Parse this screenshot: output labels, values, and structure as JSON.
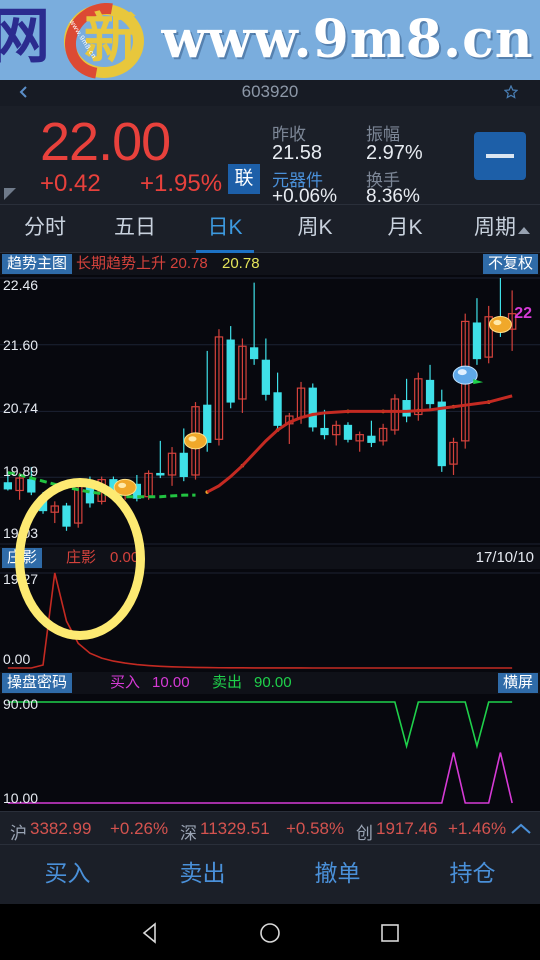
{
  "watermark": {
    "left_char": "网",
    "logo_glyph": "新",
    "logo_microtext": "www.9m8.cn",
    "url": "www.9m8.cn"
  },
  "topbar": {
    "stock_code": "603920",
    "back_icon": "back-arrow-icon",
    "star_icon": "star-icon"
  },
  "quote": {
    "price": "22.00",
    "change": "+0.42",
    "change_pct": "+1.95%",
    "link_badge": "联",
    "prev_close_label": "昨收",
    "prev_close_value": "21.58",
    "amplitude_label": "振幅",
    "amplitude_value": "2.97%",
    "sector_label": "元器件",
    "sector_value": "+0.06%",
    "turnover_label": "换手",
    "turnover_value": "8.36%",
    "collapse_icon": "minus-icon",
    "up_color": "#e8413c",
    "accent_color": "#1d5fa8"
  },
  "tabs": [
    {
      "label": "分时",
      "active": false
    },
    {
      "label": "五日",
      "active": false
    },
    {
      "label": "日K",
      "active": true
    },
    {
      "label": "周K",
      "active": false
    },
    {
      "label": "月K",
      "active": false
    },
    {
      "label": "周期",
      "active": false,
      "caret": true
    }
  ],
  "main_panel": {
    "badge": "趋势主图",
    "title_text": "长期趋势上升  20.78",
    "title_value": "20.78",
    "right_badge": "不复权",
    "axis": [
      "22.46",
      "21.60",
      "20.74",
      "19.89",
      "19.03"
    ],
    "price_tag": "22"
  },
  "sub_panel_1": {
    "badge": "庄影",
    "series_label": "庄影",
    "series_value": "0.00",
    "date": "17/10/10",
    "axis_top": "19.27",
    "axis_bottom": "0.00"
  },
  "sub_panel_2": {
    "badge": "操盘密码",
    "buy_label": "买入",
    "buy_value": "10.00",
    "sell_label": "卖出",
    "sell_value": "90.00",
    "right_badge": "横屏",
    "axis_top": "90.00",
    "axis_bottom": "10.00"
  },
  "indices": [
    {
      "name": "沪",
      "value": "3382.99",
      "pct": "+0.26%"
    },
    {
      "name": "深",
      "value": "11329.51",
      "pct": "+0.58%"
    },
    {
      "name": "创",
      "value": "1917.46",
      "pct": "+1.46%"
    }
  ],
  "index_expand_icon": "chevron-up-icon",
  "trade_actions": [
    "买入",
    "卖出",
    "撤单",
    "持仓"
  ],
  "android_nav": [
    "back-triangle-icon",
    "home-circle-icon",
    "recents-square-icon"
  ],
  "chart_data": {
    "type": "candlestick",
    "title": "趋势主图 — 603920 日K",
    "ylim": [
      19.03,
      22.46
    ],
    "yticks": [
      22.46,
      21.6,
      20.74,
      19.89,
      19.03
    ],
    "grid": true,
    "last_date": "17/10/10",
    "candles": [
      {
        "o": 19.82,
        "h": 19.96,
        "l": 19.72,
        "c": 19.74,
        "dir": "down"
      },
      {
        "o": 19.72,
        "h": 19.95,
        "l": 19.6,
        "c": 19.88,
        "dir": "up"
      },
      {
        "o": 19.86,
        "h": 20.02,
        "l": 19.66,
        "c": 19.7,
        "dir": "down"
      },
      {
        "o": 19.64,
        "h": 19.7,
        "l": 19.42,
        "c": 19.46,
        "dir": "down"
      },
      {
        "o": 19.44,
        "h": 19.58,
        "l": 19.3,
        "c": 19.52,
        "dir": "up"
      },
      {
        "o": 19.52,
        "h": 19.56,
        "l": 19.2,
        "c": 19.26,
        "dir": "down"
      },
      {
        "o": 19.3,
        "h": 19.82,
        "l": 19.24,
        "c": 19.78,
        "dir": "up"
      },
      {
        "o": 19.78,
        "h": 19.9,
        "l": 19.5,
        "c": 19.56,
        "dir": "down"
      },
      {
        "o": 19.58,
        "h": 19.9,
        "l": 19.54,
        "c": 19.86,
        "dir": "up"
      },
      {
        "o": 19.86,
        "h": 19.9,
        "l": 19.62,
        "c": 19.68,
        "dir": "down"
      },
      {
        "o": 19.7,
        "h": 19.86,
        "l": 19.6,
        "c": 19.82,
        "dir": "up"
      },
      {
        "o": 19.8,
        "h": 19.92,
        "l": 19.58,
        "c": 19.62,
        "dir": "down"
      },
      {
        "o": 19.64,
        "h": 19.98,
        "l": 19.6,
        "c": 19.94,
        "dir": "up"
      },
      {
        "o": 19.94,
        "h": 20.36,
        "l": 19.88,
        "c": 19.92,
        "dir": "down"
      },
      {
        "o": 19.92,
        "h": 20.28,
        "l": 19.78,
        "c": 20.2,
        "dir": "up"
      },
      {
        "o": 20.2,
        "h": 20.52,
        "l": 19.84,
        "c": 19.9,
        "dir": "down"
      },
      {
        "o": 19.92,
        "h": 20.86,
        "l": 19.86,
        "c": 20.8,
        "dir": "up"
      },
      {
        "o": 20.82,
        "h": 21.52,
        "l": 20.22,
        "c": 20.34,
        "dir": "down"
      },
      {
        "o": 20.38,
        "h": 21.8,
        "l": 20.3,
        "c": 21.7,
        "dir": "up"
      },
      {
        "o": 21.66,
        "h": 21.84,
        "l": 20.78,
        "c": 20.86,
        "dir": "down"
      },
      {
        "o": 20.9,
        "h": 21.68,
        "l": 20.72,
        "c": 21.58,
        "dir": "up"
      },
      {
        "o": 21.56,
        "h": 22.4,
        "l": 21.34,
        "c": 21.42,
        "dir": "down"
      },
      {
        "o": 21.4,
        "h": 21.68,
        "l": 20.88,
        "c": 20.96,
        "dir": "down"
      },
      {
        "o": 20.98,
        "h": 21.24,
        "l": 20.5,
        "c": 20.56,
        "dir": "down"
      },
      {
        "o": 20.58,
        "h": 20.72,
        "l": 20.32,
        "c": 20.68,
        "dir": "up"
      },
      {
        "o": 20.66,
        "h": 21.12,
        "l": 20.58,
        "c": 21.04,
        "dir": "up"
      },
      {
        "o": 21.04,
        "h": 21.1,
        "l": 20.48,
        "c": 20.54,
        "dir": "down"
      },
      {
        "o": 20.52,
        "h": 20.76,
        "l": 20.38,
        "c": 20.44,
        "dir": "down"
      },
      {
        "o": 20.44,
        "h": 20.62,
        "l": 20.3,
        "c": 20.56,
        "dir": "up"
      },
      {
        "o": 20.56,
        "h": 20.6,
        "l": 20.34,
        "c": 20.38,
        "dir": "down"
      },
      {
        "o": 20.36,
        "h": 20.48,
        "l": 20.22,
        "c": 20.44,
        "dir": "up"
      },
      {
        "o": 20.42,
        "h": 20.62,
        "l": 20.28,
        "c": 20.34,
        "dir": "down"
      },
      {
        "o": 20.36,
        "h": 20.58,
        "l": 20.3,
        "c": 20.52,
        "dir": "up"
      },
      {
        "o": 20.5,
        "h": 20.96,
        "l": 20.44,
        "c": 20.9,
        "dir": "up"
      },
      {
        "o": 20.88,
        "h": 21.16,
        "l": 20.6,
        "c": 20.68,
        "dir": "down"
      },
      {
        "o": 20.7,
        "h": 21.24,
        "l": 20.62,
        "c": 21.16,
        "dir": "up"
      },
      {
        "o": 21.14,
        "h": 21.34,
        "l": 20.76,
        "c": 20.84,
        "dir": "down"
      },
      {
        "o": 20.86,
        "h": 21.02,
        "l": 19.96,
        "c": 20.04,
        "dir": "down"
      },
      {
        "o": 20.06,
        "h": 20.4,
        "l": 19.92,
        "c": 20.34,
        "dir": "up"
      },
      {
        "o": 20.36,
        "h": 22.0,
        "l": 20.26,
        "c": 21.9,
        "dir": "up"
      },
      {
        "o": 21.88,
        "h": 22.2,
        "l": 21.34,
        "c": 21.42,
        "dir": "down"
      },
      {
        "o": 21.44,
        "h": 22.1,
        "l": 21.36,
        "c": 21.96,
        "dir": "up"
      },
      {
        "o": 21.94,
        "h": 22.46,
        "l": 21.7,
        "c": 21.78,
        "dir": "down"
      },
      {
        "o": 21.8,
        "h": 22.3,
        "l": 21.52,
        "c": 22.0,
        "dir": "up"
      }
    ],
    "trend_line": {
      "name": "长期趋势",
      "segments": [
        {
          "style": "dashed",
          "color": "#22c341",
          "values": [
            19.95,
            19.92,
            19.88,
            19.84,
            19.8,
            19.76,
            19.73,
            19.7,
            19.68,
            19.66,
            19.64,
            19.64,
            19.64,
            19.64,
            19.65,
            19.66,
            19.66
          ]
        },
        {
          "style": "solid",
          "color": "#c42a22",
          "values": [
            19.7,
            19.78,
            19.9,
            20.04,
            20.2,
            20.36,
            20.5,
            20.6,
            20.66,
            20.7,
            20.72,
            20.73,
            20.74,
            20.74,
            20.74,
            20.74,
            20.74,
            20.74,
            20.75,
            20.76,
            20.78,
            20.8,
            20.82,
            20.84,
            20.86,
            20.9,
            20.94
          ]
        }
      ]
    },
    "markers": [
      {
        "type": "gold-nugget",
        "x_index": 10,
        "color": "#f0a82a"
      },
      {
        "type": "gold-nugget",
        "x_index": 16,
        "color": "#f0a82a"
      },
      {
        "type": "blue-diamond",
        "x_index": 39,
        "color": "#5fa8e8"
      },
      {
        "type": "gold-nugget",
        "x_index": 42,
        "color": "#f0a82a"
      }
    ],
    "annotation_ellipse": {
      "color": "#fdea72",
      "x": 15,
      "y": 478,
      "w": 130,
      "h": 162
    },
    "sub_charts": [
      {
        "name": "庄影",
        "type": "line",
        "ylim": [
          0.0,
          19.27
        ],
        "color": "#c42a22",
        "values": [
          0,
          0,
          0,
          0.6,
          19.27,
          9.5,
          5.0,
          3.0,
          2.0,
          1.4,
          1.0,
          0.7,
          0.5,
          0.35,
          0.25,
          0.18,
          0.12,
          0.08,
          0.05,
          0.04,
          0.03,
          0.02,
          0.02,
          0.01,
          0.01,
          0.01,
          0,
          0,
          0,
          0,
          0,
          0,
          0,
          0,
          0,
          0,
          0,
          0,
          0,
          0,
          0,
          0,
          0,
          0
        ]
      },
      {
        "name": "操盘密码",
        "type": "line",
        "ylim": [
          10.0,
          90.0
        ],
        "series": [
          {
            "name": "卖出",
            "color": "#1fd14b",
            "values": [
              90,
              90,
              90,
              90,
              90,
              90,
              90,
              90,
              90,
              90,
              90,
              90,
              90,
              90,
              90,
              90,
              90,
              90,
              90,
              90,
              90,
              90,
              90,
              90,
              90,
              90,
              90,
              90,
              90,
              90,
              90,
              90,
              90,
              90,
              55,
              90,
              90,
              90,
              90,
              90,
              55,
              90,
              90,
              90
            ]
          },
          {
            "name": "买入",
            "color": "#d63ad6",
            "values": [
              10,
              10,
              10,
              10,
              10,
              10,
              10,
              10,
              10,
              10,
              10,
              10,
              10,
              10,
              10,
              10,
              10,
              10,
              10,
              10,
              10,
              10,
              10,
              10,
              10,
              10,
              10,
              10,
              10,
              10,
              10,
              10,
              10,
              10,
              10,
              10,
              10,
              10,
              50,
              10,
              10,
              10,
              50,
              10
            ]
          }
        ]
      }
    ]
  }
}
